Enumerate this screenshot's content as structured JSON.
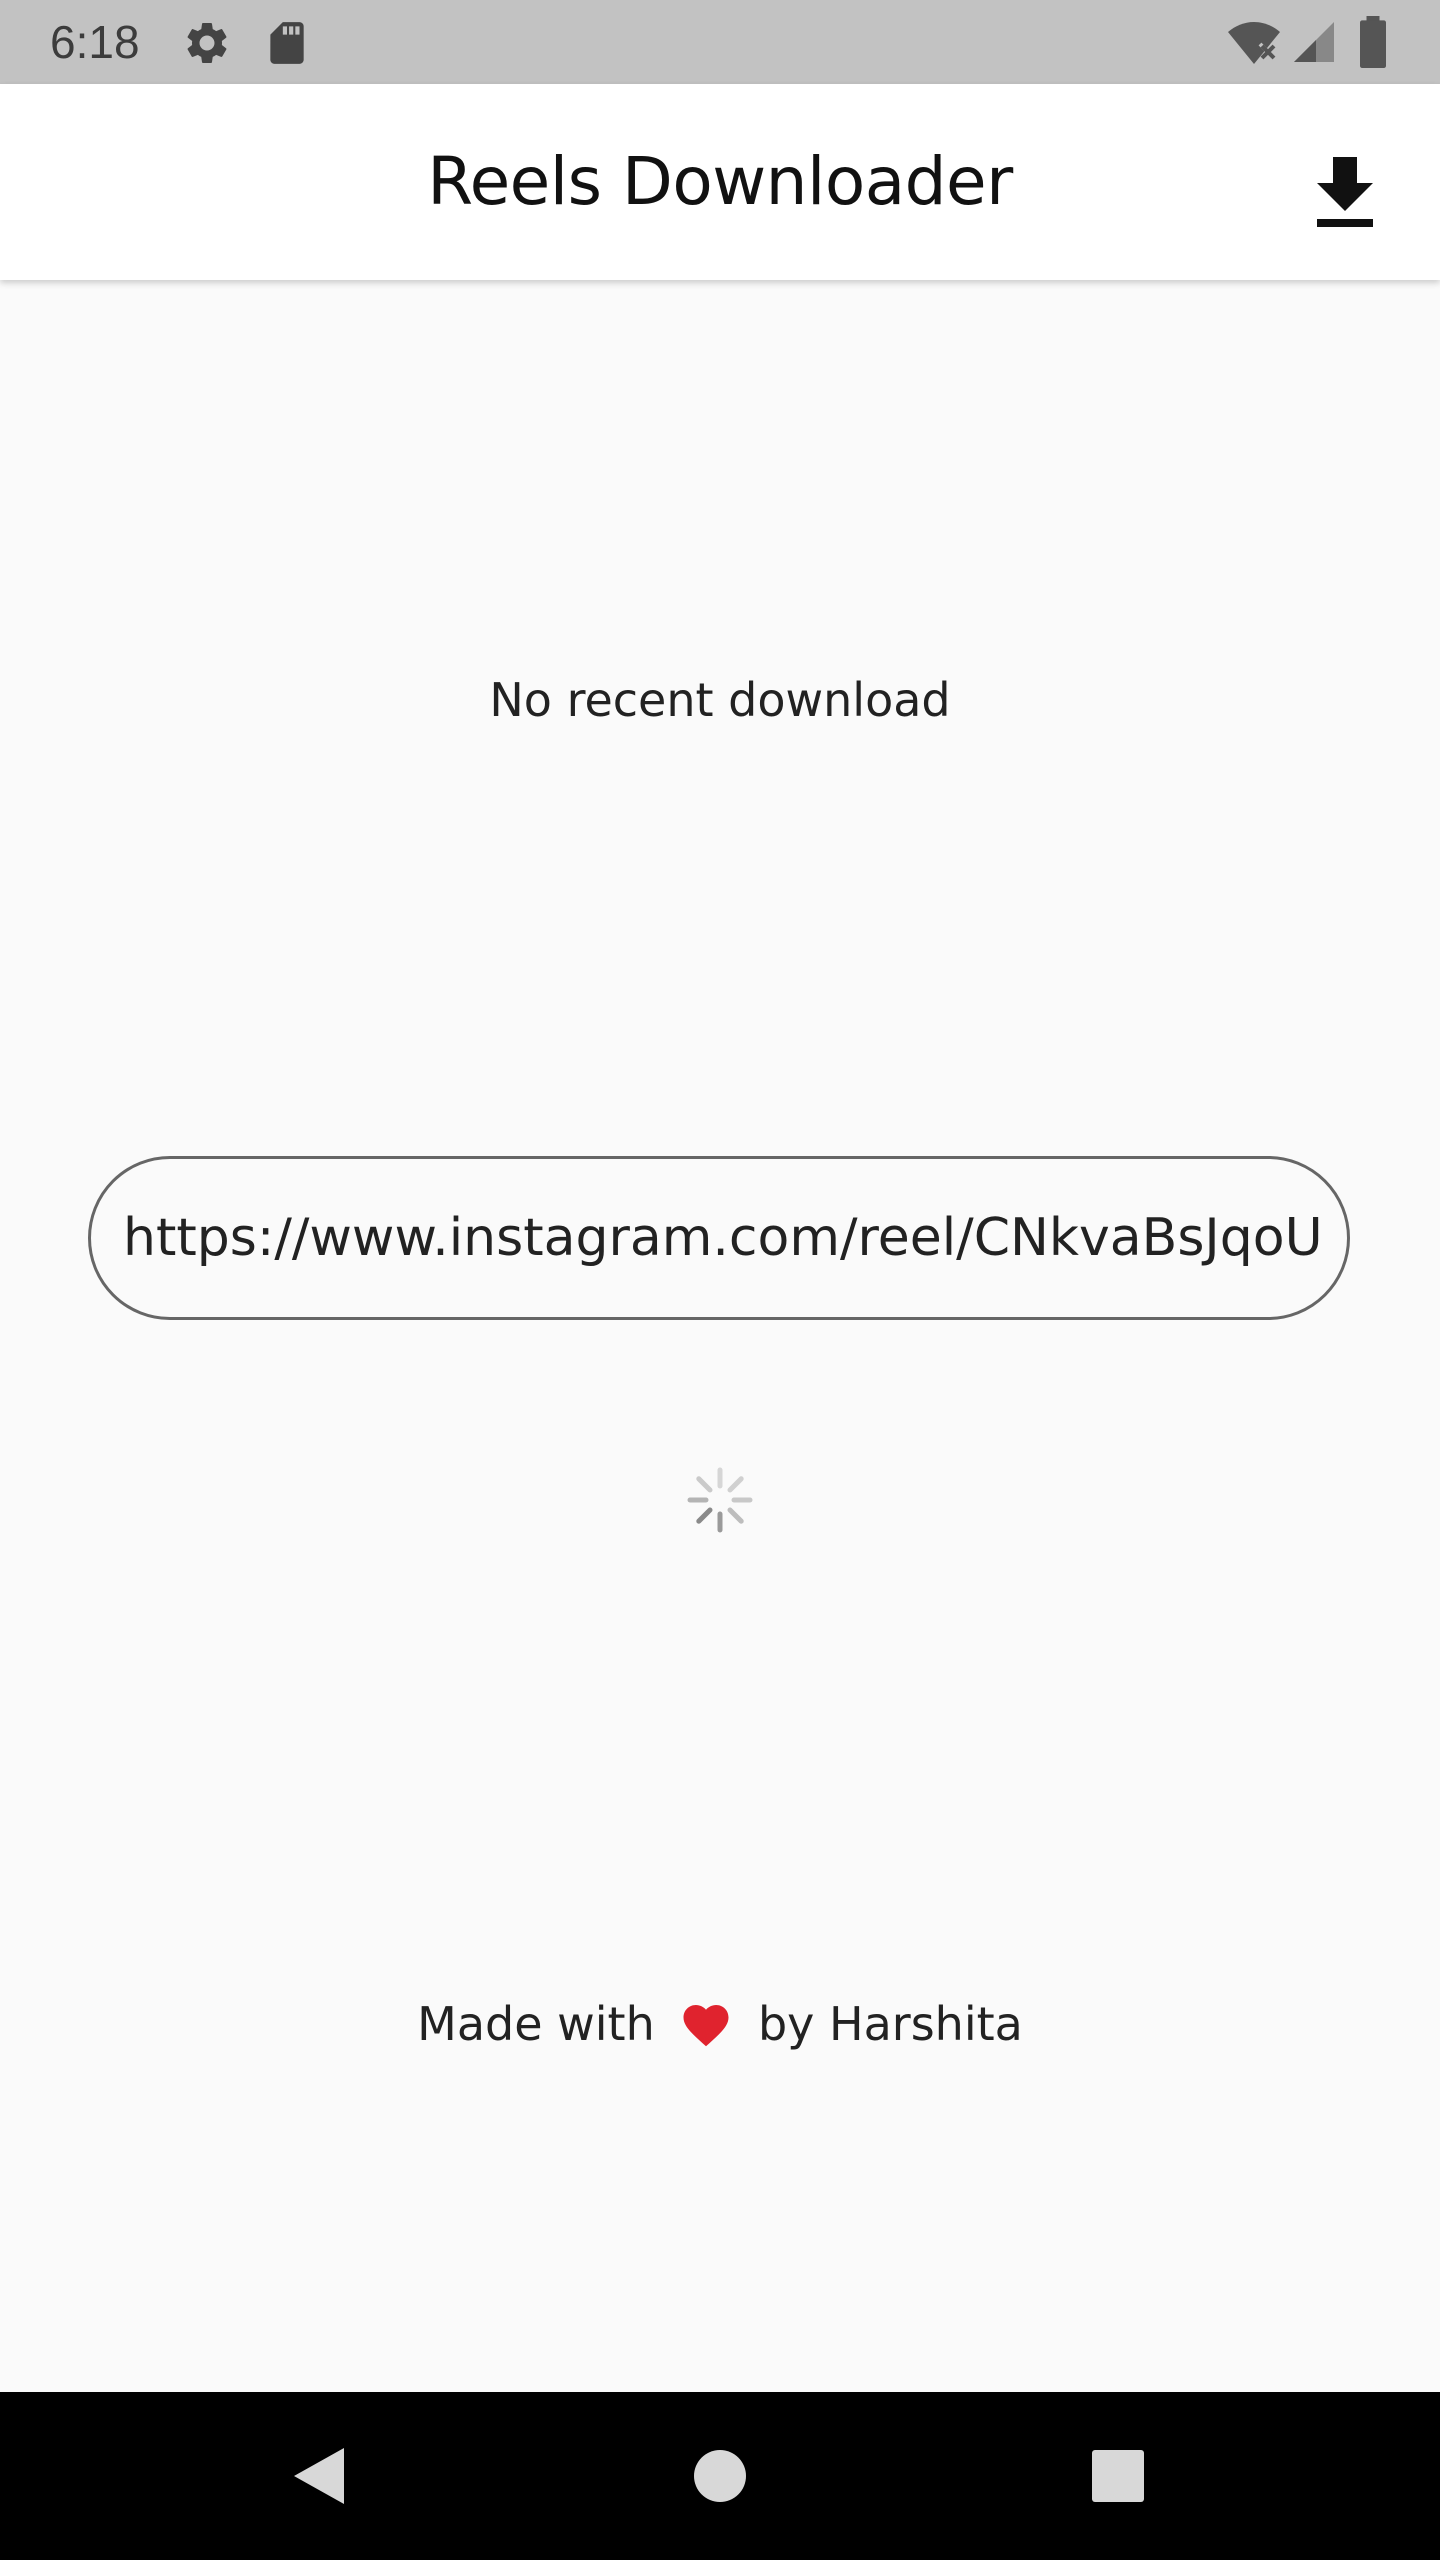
{
  "status_bar": {
    "time": "6:18",
    "icons": [
      "settings-icon",
      "sd-card-icon",
      "wifi-off-icon",
      "signal-icon",
      "battery-icon"
    ]
  },
  "app_bar": {
    "title": "Reels Downloader",
    "action_icon": "download-icon"
  },
  "main": {
    "recent_status": "No recent download",
    "url_field": {
      "value": "https://www.instagram.com/reel/CNkvaBsJqoU/"
    },
    "loading": true
  },
  "footer": {
    "prefix": "Made with",
    "heart": "heart-icon",
    "suffix": "by Harshita"
  },
  "nav_bar": {
    "buttons": [
      "back-icon",
      "home-icon",
      "recents-icon"
    ]
  },
  "colors": {
    "status_bar": "#c2c2c2",
    "app_bar": "#ffffff",
    "background": "#fafafa",
    "heart": "#e0232e",
    "nav_bar": "#000000"
  }
}
